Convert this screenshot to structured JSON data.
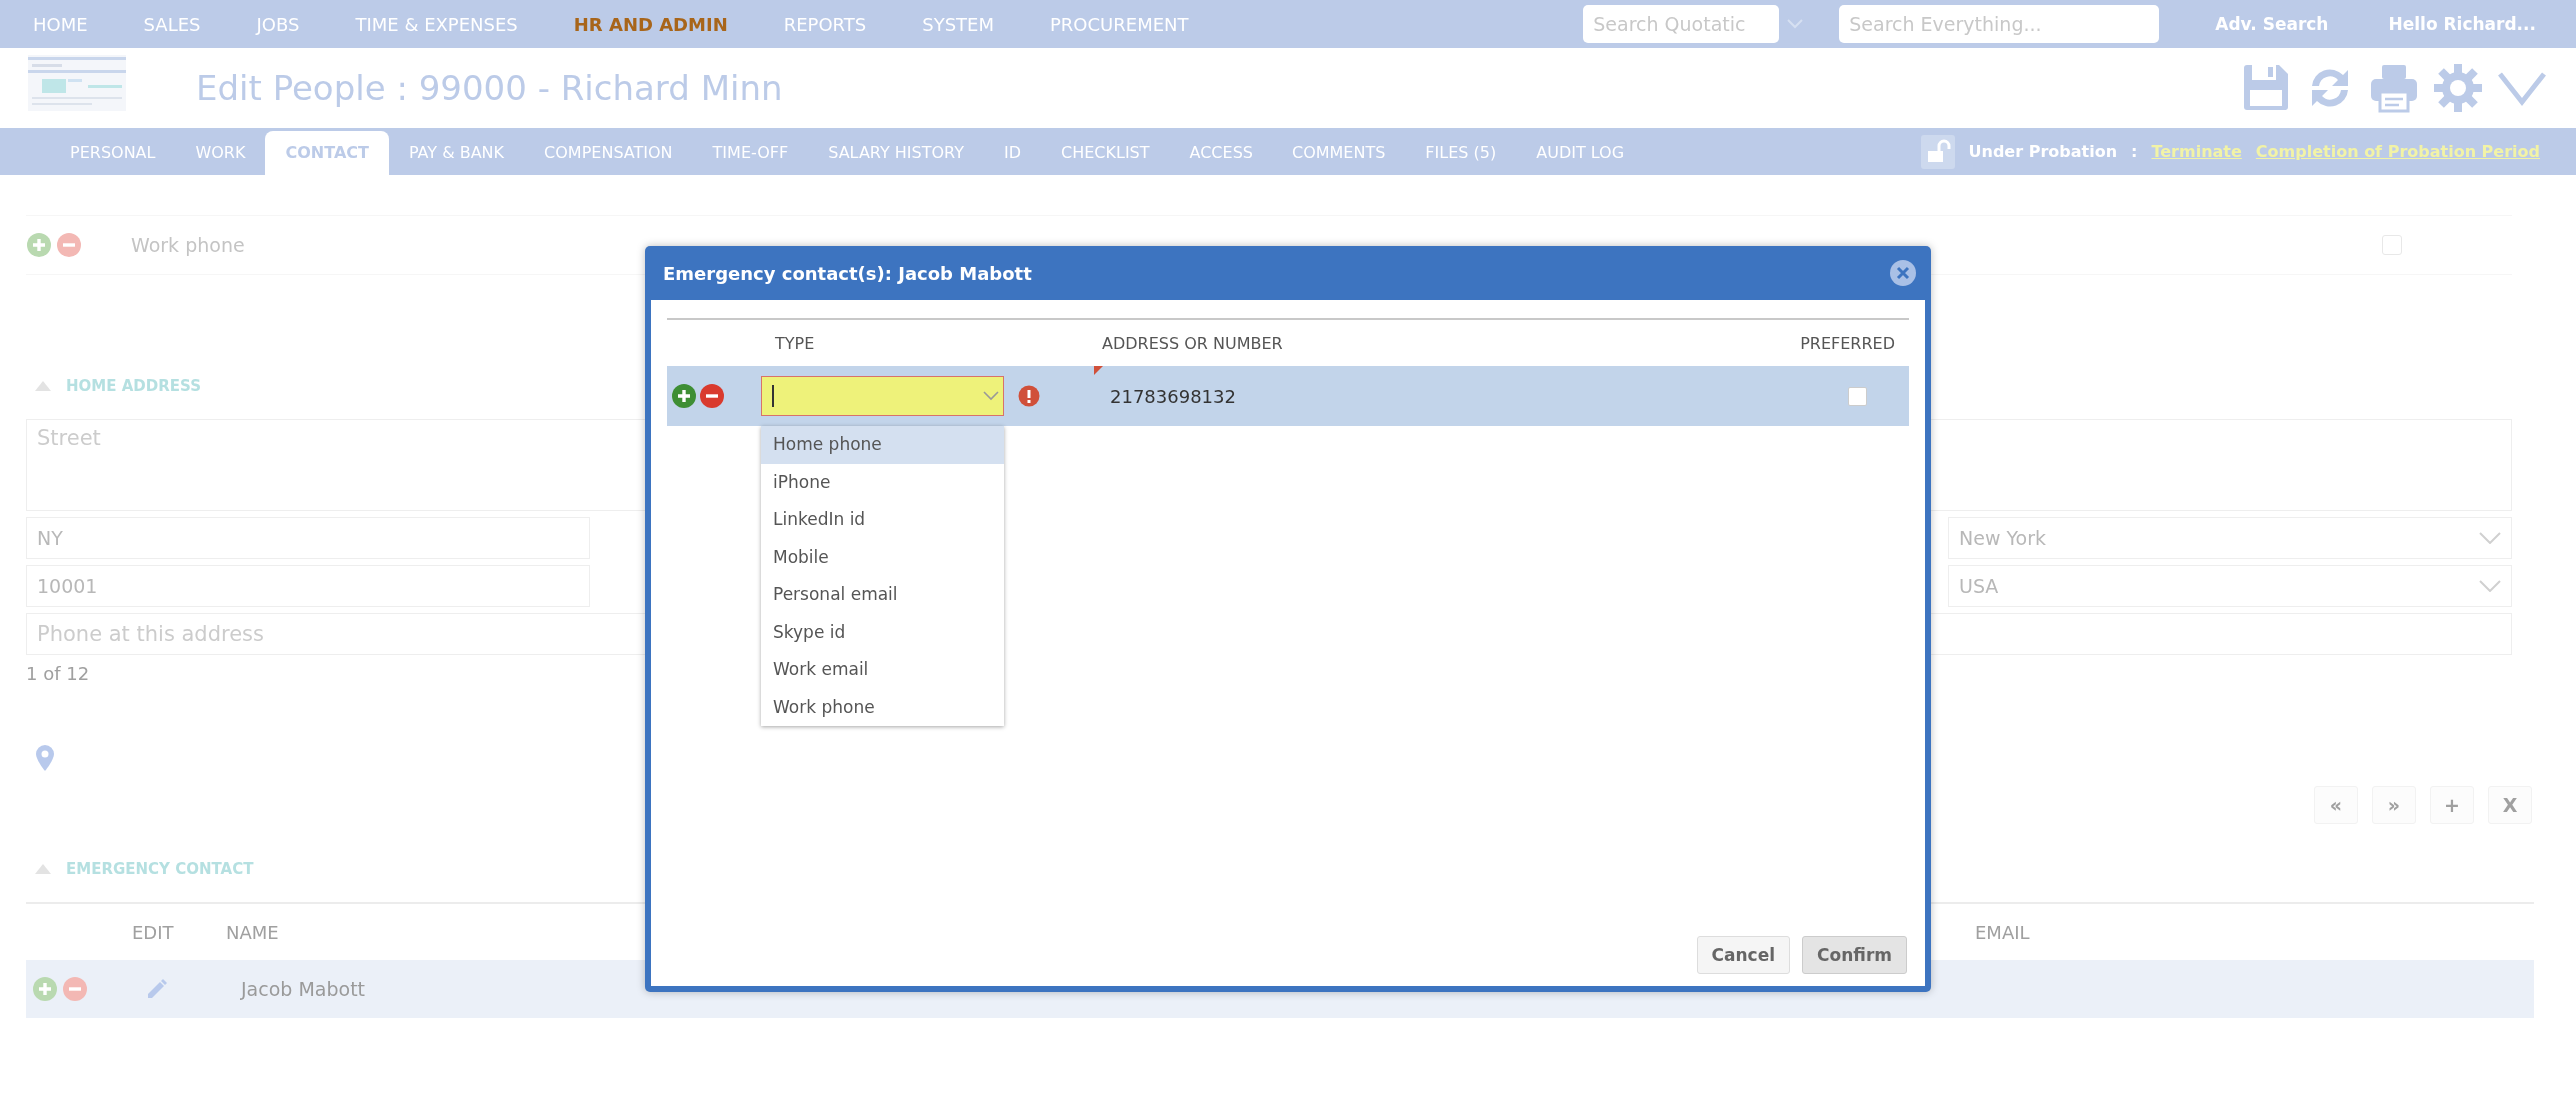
{
  "nav": {
    "items": [
      {
        "label": "HOME",
        "selected": false
      },
      {
        "label": "SALES",
        "selected": false
      },
      {
        "label": "JOBS",
        "selected": false
      },
      {
        "label": "TIME & EXPENSES",
        "selected": false
      },
      {
        "label": "HR AND ADMIN",
        "selected": true
      },
      {
        "label": "REPORTS",
        "selected": false
      },
      {
        "label": "SYSTEM",
        "selected": false
      },
      {
        "label": "PROCUREMENT",
        "selected": false
      }
    ],
    "quotation_search": {
      "placeholder": "Search Quotatic"
    },
    "global_search": {
      "placeholder": "Search Everything..."
    },
    "adv_search": "Adv. Search",
    "greeting": "Hello Richard..."
  },
  "header": {
    "title": "Edit People : 99000 - Richard Minn"
  },
  "tabs": [
    {
      "label": "PERSONAL",
      "selected": false
    },
    {
      "label": "WORK",
      "selected": false
    },
    {
      "label": "CONTACT",
      "selected": true
    },
    {
      "label": "PAY & BANK",
      "selected": false
    },
    {
      "label": "COMPENSATION",
      "selected": false
    },
    {
      "label": "TIME-OFF",
      "selected": false
    },
    {
      "label": "SALARY HISTORY",
      "selected": false
    },
    {
      "label": "ID",
      "selected": false
    },
    {
      "label": "CHECKLIST",
      "selected": false
    },
    {
      "label": "ACCESS",
      "selected": false
    },
    {
      "label": "COMMENTS",
      "selected": false
    },
    {
      "label": "FILES (5)",
      "selected": false
    },
    {
      "label": "AUDIT LOG",
      "selected": false
    }
  ],
  "probation": {
    "status": "Under Probation",
    "separator": ":",
    "links": [
      "Terminate",
      "Completion of Probation Period"
    ]
  },
  "contact_rows": [
    {
      "label": "Work phone",
      "preferred": false
    }
  ],
  "home_address": {
    "title": "HOME ADDRESS",
    "street": {
      "placeholder": "Street"
    },
    "state": "NY",
    "city": "New York",
    "zip": "10001",
    "country": "USA",
    "phone": {
      "placeholder": "Phone at this address"
    },
    "record_count": "1 of 12"
  },
  "pager": [
    "«",
    "»",
    "+",
    "X"
  ],
  "emergency_contact": {
    "title": "EMERGENCY CONTACT",
    "columns": [
      "EDIT",
      "NAME",
      "EMAIL"
    ],
    "rows": [
      {
        "name": "Jacob Mabott"
      }
    ]
  },
  "modal": {
    "title": "Emergency contact(s): Jacob Mabott",
    "columns": [
      "TYPE",
      "ADDRESS OR NUMBER",
      "PREFERRED"
    ],
    "rows": [
      {
        "type": "",
        "invalid": true,
        "address": "21783698132",
        "preferred": false
      }
    ],
    "options": [
      {
        "label": "Home phone",
        "selected": true
      },
      {
        "label": "iPhone",
        "selected": false
      },
      {
        "label": "LinkedIn id",
        "selected": false
      },
      {
        "label": "Mobile",
        "selected": false
      },
      {
        "label": "Personal email",
        "selected": false
      },
      {
        "label": "Skype id",
        "selected": false
      },
      {
        "label": "Work email",
        "selected": false
      },
      {
        "label": "Work phone",
        "selected": false
      }
    ],
    "buttons": [
      "Cancel",
      "Confirm"
    ]
  }
}
